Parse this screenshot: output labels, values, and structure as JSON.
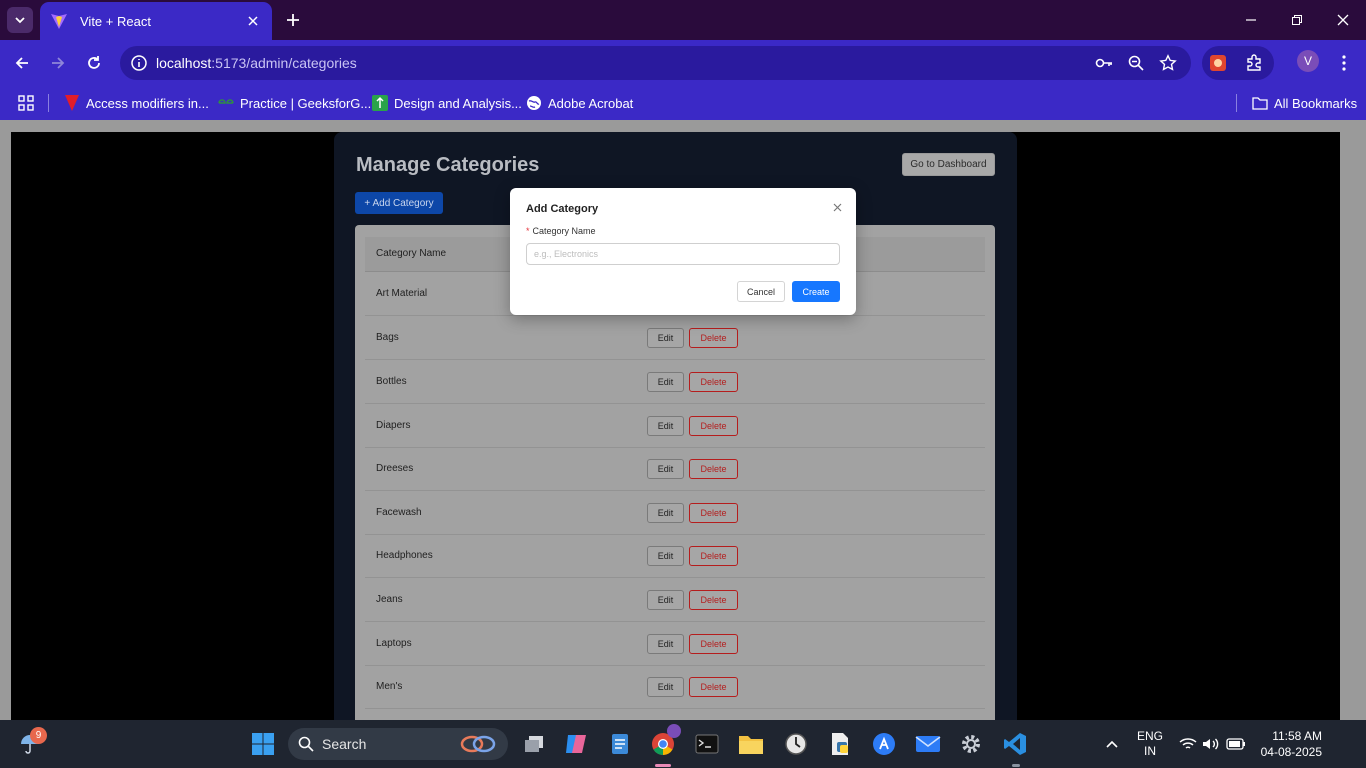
{
  "browser": {
    "tab_title": "Vite + React",
    "url_host": "localhost",
    "url_path": ":5173/admin/categories",
    "profile_initial": "V",
    "bookmarks": [
      {
        "label": "Access modifiers in..."
      },
      {
        "label": "Practice | GeeksforG..."
      },
      {
        "label": "Design and Analysis..."
      },
      {
        "label": "Adobe Acrobat"
      }
    ],
    "all_bookmarks": "All Bookmarks"
  },
  "page": {
    "title": "Manage Categories",
    "dashboard_button": "Go to Dashboard",
    "add_button": "+ Add Category",
    "table_header": "Category Name",
    "edit_label": "Edit",
    "delete_label": "Delete",
    "rows": [
      "Art Material",
      "Bags",
      "Bottles",
      "Diapers",
      "Dreeses",
      "Facewash",
      "Headphones",
      "Jeans",
      "Laptops",
      "Men's"
    ]
  },
  "modal": {
    "title": "Add Category",
    "field_label": "Category Name",
    "required_mark": "*",
    "placeholder": "e.g., Electronics",
    "cancel": "Cancel",
    "create": "Create"
  },
  "taskbar": {
    "weather_badge": "9",
    "search_label": "Search",
    "lang_line1": "ENG",
    "lang_line2": "IN",
    "time": "11:58 AM",
    "date": "04-08-2025"
  },
  "colors": {
    "chrome": "#3b29c6",
    "primary": "#1677ff",
    "danger": "#b32020"
  }
}
